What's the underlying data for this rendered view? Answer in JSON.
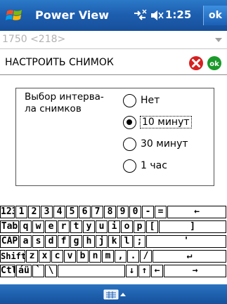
{
  "titlebar": {
    "app_title": "Power View",
    "clock": "1:25",
    "ok_label": "ok"
  },
  "dropdown": {
    "value": "1750 <218>"
  },
  "header": {
    "title": "НАСТРОИТЬ СНИМОК"
  },
  "form": {
    "label_line1": "Выбор интерва-",
    "label_line2": "ла снимков",
    "options": [
      {
        "label": "Нет",
        "selected": false
      },
      {
        "label": "10 минут",
        "selected": true
      },
      {
        "label": "30 минут",
        "selected": false
      },
      {
        "label": "1 час",
        "selected": false
      }
    ]
  },
  "keyboard": {
    "rows": [
      [
        "123",
        "1",
        "2",
        "3",
        "4",
        "5",
        "6",
        "7",
        "8",
        "9",
        "0",
        "-",
        "=",
        "←"
      ],
      [
        "Tab",
        "q",
        "w",
        "e",
        "r",
        "t",
        "y",
        "u",
        "i",
        "o",
        "p",
        "[",
        "]"
      ],
      [
        "CAP",
        "a",
        "s",
        "d",
        "f",
        "g",
        "h",
        "j",
        "k",
        "l",
        ";",
        "'"
      ],
      [
        "Shift",
        "z",
        "x",
        "c",
        "v",
        "b",
        "n",
        "m",
        ",",
        ".",
        "/",
        "↵"
      ],
      [
        "Ctl",
        "áü",
        "`",
        "\\",
        "",
        "↓",
        "↑",
        "←",
        "→"
      ]
    ]
  },
  "colors": {
    "titlebar": "#1e5fb0",
    "cancel_red": "#d62020",
    "ok_green": "#1a9a2a"
  }
}
